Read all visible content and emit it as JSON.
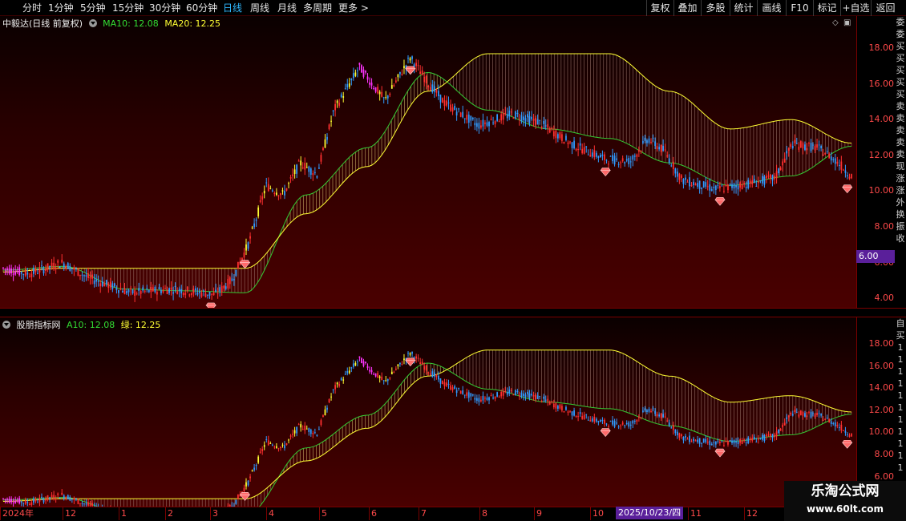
{
  "toolbar": {
    "periods": [
      "分时",
      "1分钟",
      "5分钟",
      "15分钟",
      "30分钟",
      "60分钟",
      "日线",
      "周线",
      "月线",
      "多周期",
      "更多 >"
    ],
    "active_period": "日线",
    "buttons": [
      "复权",
      "叠加",
      "多股",
      "统计",
      "画线",
      "F10",
      "标记",
      "+自选",
      "返回"
    ]
  },
  "panel1": {
    "stock_name": "中毅达(日线 前复权)",
    "ma10_label": "MA10: 12.08",
    "ma20_label": "MA20: 12.25",
    "price_ticks": [
      "18.00",
      "16.00",
      "14.00",
      "12.00",
      "10.00",
      "8.00",
      "6.00",
      "4.00"
    ],
    "price_tag": "6.00"
  },
  "panel2": {
    "indicator_name": "股朋指标网",
    "a10_label": "A10: 12.08",
    "green_label": "绿: 12.25",
    "price_ticks": [
      "18.00",
      "16.00",
      "14.00",
      "12.00",
      "10.00",
      "8.00",
      "6.00"
    ]
  },
  "right_strip": {
    "top_chars": [
      "委",
      "委",
      "买",
      "买",
      "买",
      "买",
      "买",
      "卖",
      "卖",
      "卖",
      "卖",
      "卖",
      "现",
      "涨",
      "涨",
      "外",
      "换",
      "振",
      "收"
    ],
    "bottom_chars": [
      "自",
      "买",
      "1",
      "1",
      "1",
      "1",
      "1",
      "1",
      "1",
      "1",
      "1",
      "1",
      "1"
    ]
  },
  "time_axis": {
    "labels": [
      "2024年",
      "12",
      "1",
      "2",
      "3",
      "4",
      "5",
      "6",
      "7",
      "8",
      "9",
      "10",
      "11",
      "12",
      "1"
    ],
    "cursor_date": "2025/10/23/四"
  },
  "watermark": {
    "title": "乐淘公式网",
    "url": "www.60lt.com"
  },
  "colors": {
    "background": "#000000",
    "panel_red": "#4a0000",
    "up_candle": "#ff3030",
    "down_candle": "#2f9bff",
    "yellow_band": "#ffff33",
    "green_band": "#33cc33",
    "magenta_bar": "#ff33ff",
    "accent_purple": "#5a1f9a"
  },
  "chart_data": {
    "type": "line",
    "title": "中毅达(日线 前复权)",
    "xlabel": "",
    "ylabel": "",
    "x": [
      "2024-11",
      "2024-12",
      "2025-01",
      "2025-02",
      "2025-03",
      "2025-04",
      "2025-05",
      "2025-06",
      "2025-07",
      "2025-08",
      "2025-09",
      "2025-10",
      "2025-11",
      "2025-12",
      "2026-01"
    ],
    "series": [
      {
        "name": "MA10",
        "values": [
          5.5,
          5.7,
          4.5,
          4.4,
          4.3,
          9.5,
          12.0,
          16.0,
          14.0,
          13.0,
          12.5,
          11.2,
          10.0,
          10.5,
          12.08
        ]
      },
      {
        "name": "MA20",
        "values": [
          5.4,
          5.6,
          5.6,
          5.6,
          5.6,
          8.5,
          11.0,
          15.0,
          17.0,
          17.0,
          17.0,
          15.0,
          13.0,
          13.5,
          12.25
        ]
      }
    ],
    "ylim": [
      3.5,
      19.0
    ],
    "grid": false,
    "legend": "top-left"
  }
}
